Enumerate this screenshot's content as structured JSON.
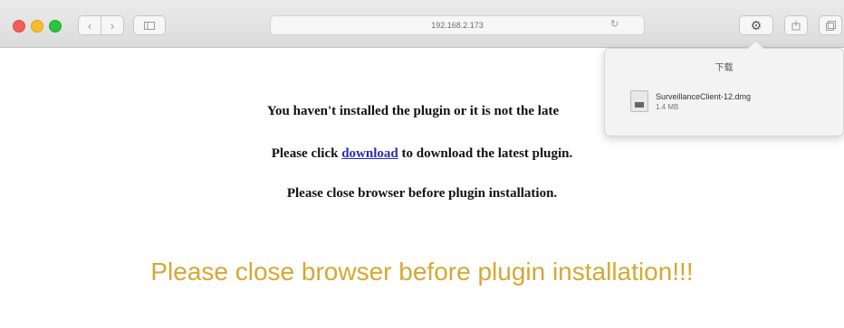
{
  "browser": {
    "address_url": "192.168.2.173",
    "nav_back_icon": "chevron-left-icon",
    "nav_forward_icon": "chevron-right-icon",
    "sidebar_icon": "sidebar-icon",
    "reload_icon": "reload-icon",
    "downloads_icon": "download-gear-icon",
    "share_icon": "share-icon",
    "tabs_icon": "tabs-icon",
    "traffic_colors": {
      "close": "#f25f57",
      "minimize": "#f6bd2e",
      "maximize": "#2fc43f"
    }
  },
  "downloads_popover": {
    "title": "下载",
    "file_name": "SurveillanceClient-12.dmg",
    "file_size": "1.4 MB",
    "file_icon": "dmg-file-icon"
  },
  "page": {
    "line1": "You haven't installed the plugin or it is not the late",
    "line2_prefix": "Please click ",
    "line2_link": "download",
    "line2_suffix": " to download the latest plugin.",
    "line3": "Please close browser before plugin installation.",
    "warning": "Please close browser before plugin installation!!!",
    "warning_color": "#d7a733",
    "link_color": "#2a2ab8"
  }
}
